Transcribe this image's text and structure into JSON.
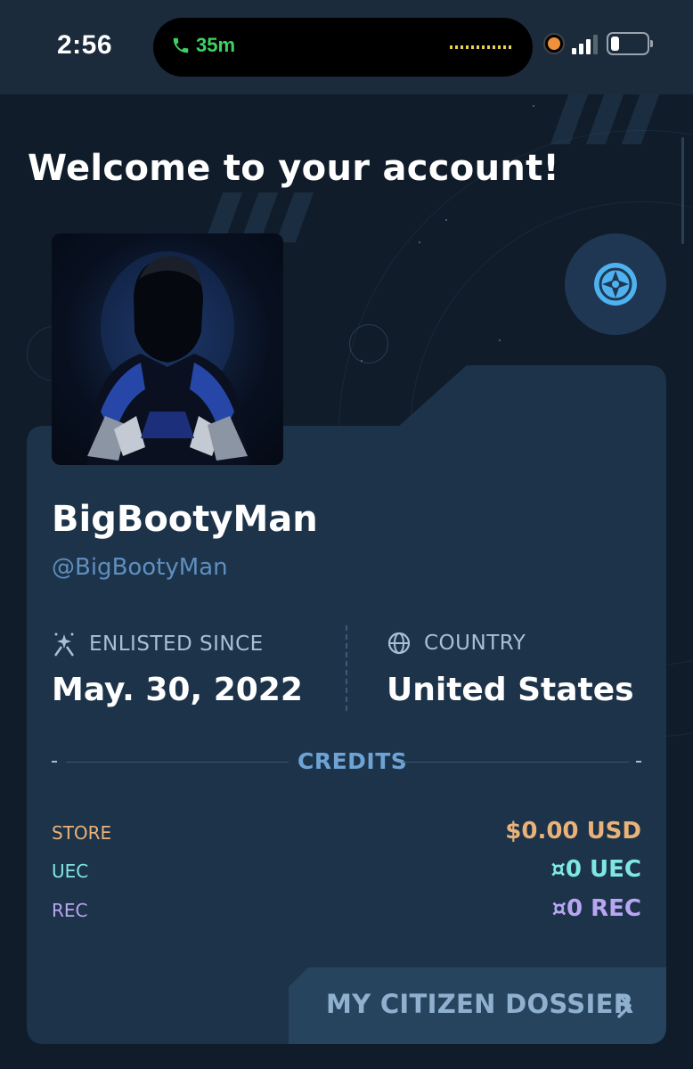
{
  "status_bar": {
    "time": "2:56",
    "call_duration": "35m"
  },
  "page": {
    "title": "Welcome to your account!"
  },
  "profile": {
    "display_name": "BigBootyMan",
    "handle": "@BigBootyMan",
    "enlisted_label": "ENLISTED SINCE",
    "enlisted_value": "May. 30, 2022",
    "country_label": "COUNTRY",
    "country_value": "United States"
  },
  "credits": {
    "heading": "CREDITS",
    "rows": [
      {
        "label": "STORE",
        "value": "$0.00 USD",
        "color": "#e8b27a"
      },
      {
        "label": "UEC",
        "value": "¤0 UEC",
        "color": "#7fe7e3"
      },
      {
        "label": "REC",
        "value": "¤0 REC",
        "color": "#b9a6f2"
      }
    ]
  },
  "actions": {
    "dossier_label": "MY CITIZEN DOSSIER"
  },
  "colors": {
    "accent_blue": "#4fb2f0",
    "card_bg": "#1d3349",
    "page_bg": "#101c2a"
  },
  "icons": [
    "phone-icon",
    "signal-icon",
    "battery-icon",
    "radar-icon",
    "enlisted-icon",
    "globe-icon",
    "chevron-right-icon"
  ]
}
